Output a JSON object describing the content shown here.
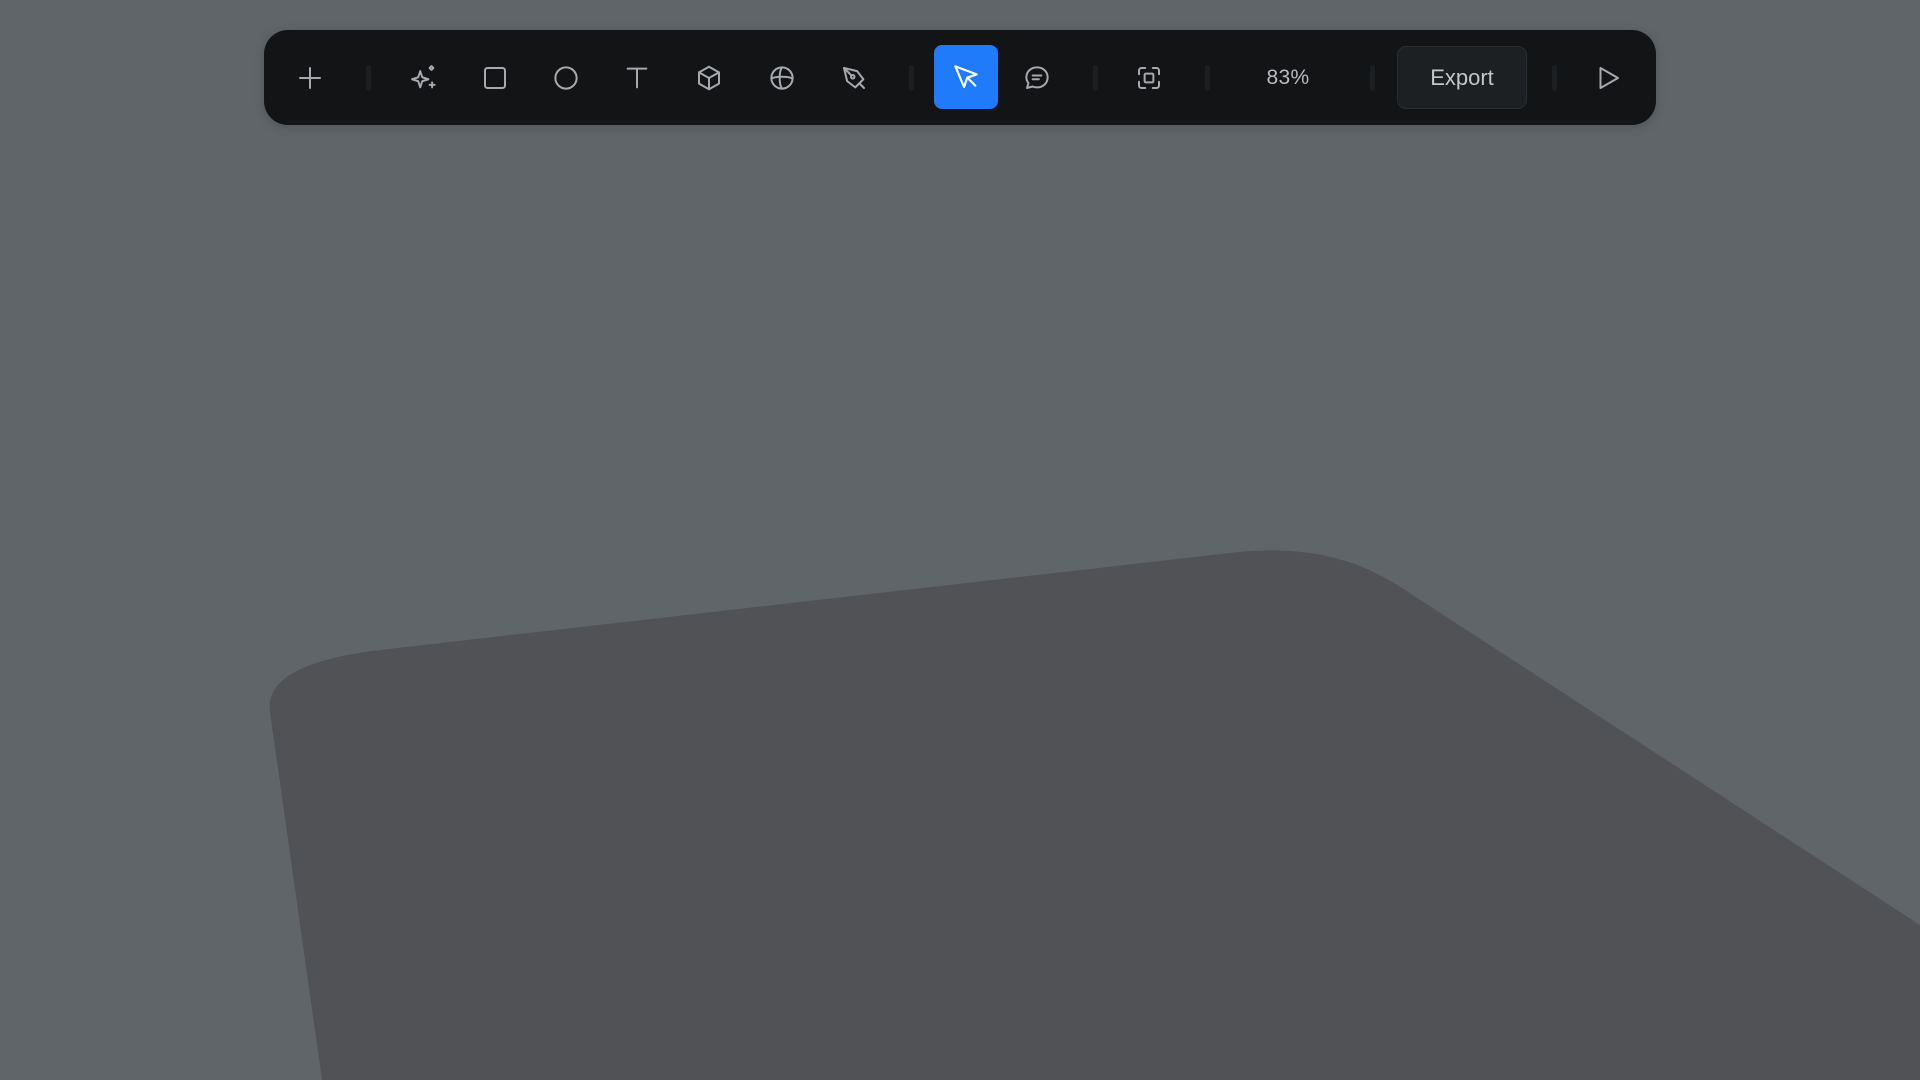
{
  "toolbar": {
    "tools": [
      {
        "id": "add",
        "icon": "plus-icon"
      },
      {
        "id": "ai",
        "icon": "sparkle-icon"
      },
      {
        "id": "rectangle",
        "icon": "rectangle-icon"
      },
      {
        "id": "ellipse",
        "icon": "ellipse-icon"
      },
      {
        "id": "text",
        "icon": "text-icon"
      },
      {
        "id": "cube",
        "icon": "cube-icon"
      },
      {
        "id": "sphere",
        "icon": "sphere-icon"
      },
      {
        "id": "pen",
        "icon": "pen-tool-icon"
      },
      {
        "id": "select",
        "icon": "cursor-arrow-icon",
        "active": true
      },
      {
        "id": "comment",
        "icon": "comment-icon"
      },
      {
        "id": "frame",
        "icon": "frame-focus-icon"
      },
      {
        "id": "play",
        "icon": "play-icon"
      }
    ],
    "zoom_label": "83%",
    "export_label": "Export"
  },
  "colors": {
    "background": "#5f6569",
    "toolbar": "#121416",
    "active_accent": "#1f7bfa",
    "canvas_object": "#505256"
  }
}
